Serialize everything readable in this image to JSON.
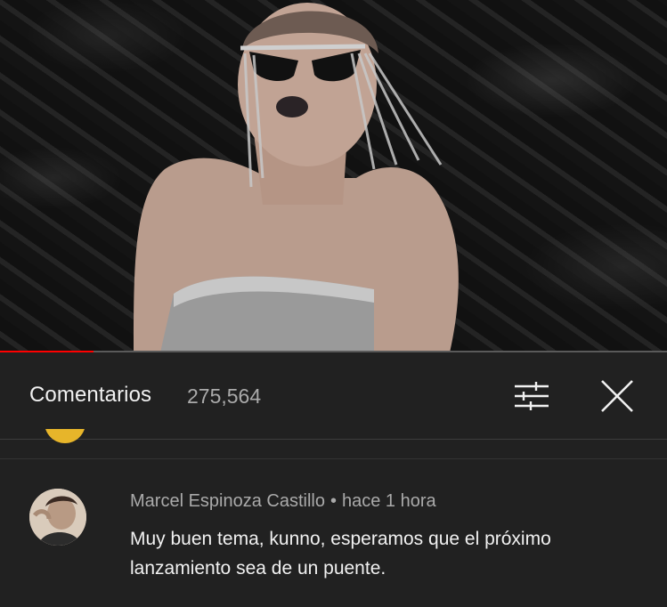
{
  "video": {
    "progress_fraction": 0.14,
    "progress_color": "#ff0000",
    "track_color": "#5a5a5a"
  },
  "comments_panel": {
    "title": "Comentarios",
    "count": "275,564",
    "filter_icon": "tune-icon",
    "close_icon": "close-icon"
  },
  "comment": {
    "author": "Marcel Espinoza Castillo",
    "separator": "•",
    "time": "hace 1 hora",
    "text": "Muy buen tema, kunno, esperamos que el próximo lanzamiento sea de un puente."
  }
}
